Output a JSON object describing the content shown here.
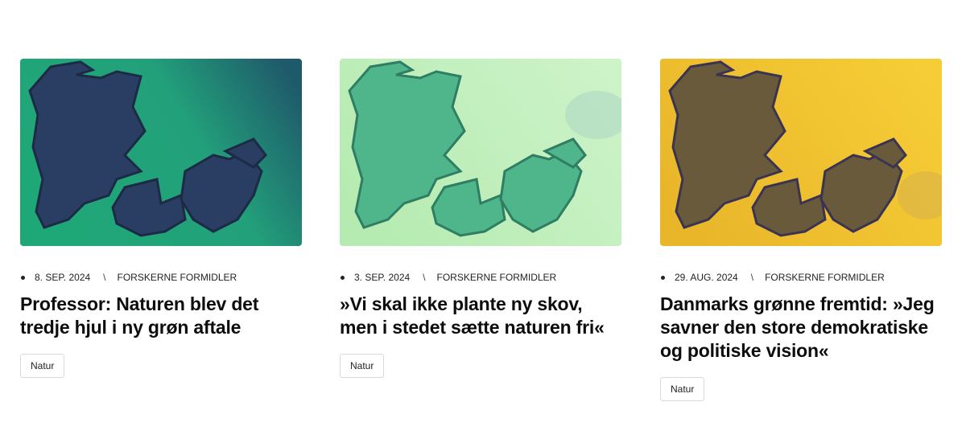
{
  "articles": [
    {
      "date": "8. SEP. 2024",
      "separator": "\\",
      "category": "FORSKERNE FORMIDLER",
      "title": "Professor: Naturen blev det tredje hjul i ny grøn aftale",
      "tag": "Natur",
      "image": {
        "icon": "denmark-map-illustration",
        "bg_light": "#1fa877",
        "bg_dark": "#1f5a6b",
        "land": "#2a3e63",
        "outline": "#1d2a45"
      }
    },
    {
      "date": "3. SEP. 2024",
      "separator": "\\",
      "category": "FORSKERNE FORMIDLER",
      "title": "»Vi skal ikke plante ny skov, men i stedet sætte naturen fri«",
      "tag": "Natur",
      "image": {
        "icon": "denmark-map-illustration",
        "bg_light": "#c9f2c4",
        "bg_dark": "#aee8ab",
        "land": "#4fb58a",
        "outline": "#2f7d63"
      }
    },
    {
      "date": "29. AUG. 2024",
      "separator": "\\",
      "category": "FORSKERNE FORMIDLER",
      "title": "Danmarks grønne fremtid: »Jeg savner den store demokratiske og politiske vision«",
      "tag": "Natur",
      "image": {
        "icon": "denmark-map-illustration",
        "bg_light": "#f7cc33",
        "bg_dark": "#e7b52b",
        "land": "#6a5a3c",
        "outline": "#3b3352"
      }
    }
  ]
}
